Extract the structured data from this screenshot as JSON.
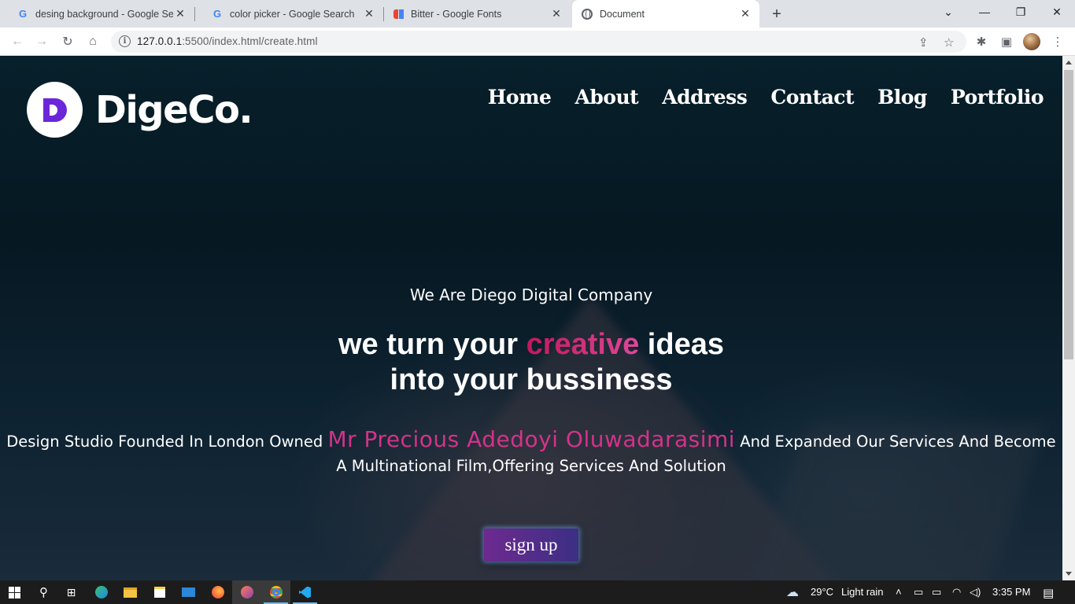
{
  "browser": {
    "tabs": [
      {
        "title": "desing background - Google Sea",
        "icon": "google-icon"
      },
      {
        "title": "color picker - Google Search",
        "icon": "google-icon"
      },
      {
        "title": "Bitter - Google Fonts",
        "icon": "google-fonts-icon"
      },
      {
        "title": "Document",
        "icon": "globe-icon",
        "active": true
      }
    ],
    "url_host": "127.0.0.1",
    "url_rest": ":5500/index.html/create.html"
  },
  "site": {
    "logo_text": "DigeCo.",
    "nav": [
      "Home",
      "About",
      "Address",
      "Contact",
      "Blog",
      "Portfolio"
    ],
    "eyebrow": "We Are Diego Digital Company",
    "headline_pre": "we turn your ",
    "headline_accent": "creative",
    "headline_post": " ideas",
    "headline_line2": "into your bussiness",
    "sub_pre": "Design Studio Founded In London Owned ",
    "sub_owner": "Mr Precious Adedoyi Oluwadarasimi",
    "sub_post": " And Expanded Our Services And Become",
    "sub_line2": "A Multinational Film,Offering Services And Solution",
    "signup_label": "sign up"
  },
  "taskbar": {
    "weather_temp": "29°C",
    "weather_text": "Light rain",
    "time": "3:35 PM"
  }
}
